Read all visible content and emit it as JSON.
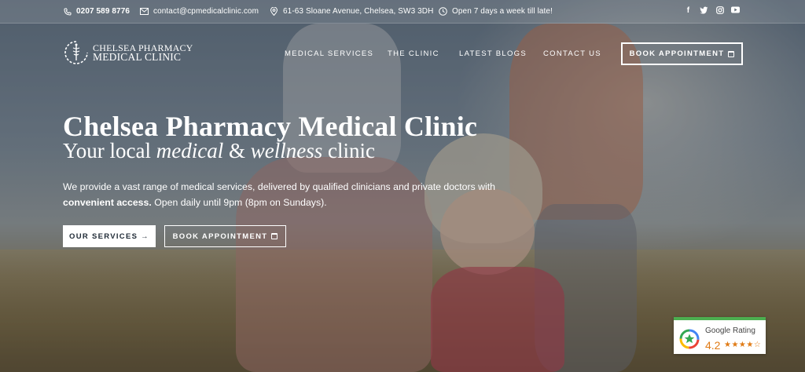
{
  "topbar": {
    "phone": "0207 589 8776",
    "email": "contact@cpmedicalclinic.com",
    "address": "61-63 Sloane Avenue, Chelsea, SW3 3DH",
    "hours": "Open 7 days a week till late!",
    "social": [
      "facebook-icon",
      "twitter-icon",
      "instagram-icon",
      "youtube-icon"
    ]
  },
  "header": {
    "logo_line1": "CHELSEA PHARMACY",
    "logo_line2": "MEDICAL CLINIC",
    "nav": [
      "MEDICAL SERVICES",
      "THE CLINIC",
      "LATEST BLOGS",
      "CONTACT US"
    ],
    "book_label": "BOOK APPOINTMENT"
  },
  "hero": {
    "title": "Chelsea Pharmacy Medical Clinic",
    "subtitle_pre": "Your local ",
    "subtitle_em1": "medical",
    "subtitle_mid": " & ",
    "subtitle_em2": "wellness",
    "subtitle_post": " clinic",
    "lead_text": "We provide a vast range of medical services, delivered by qualified clinicians and private doctors with ",
    "lead_bold": "convenient access.",
    "lead_tail": " Open daily until 9pm (8pm on Sundays).",
    "cta_services": "OUR SERVICES →",
    "cta_book": "BOOK APPOINTMENT"
  },
  "rating": {
    "label": "Google Rating",
    "score": "4.2",
    "stars": "★★★★☆",
    "stars_value": 4.2
  },
  "colors": {
    "accent_green": "#4caf50",
    "star_orange": "#e07b16",
    "overlay": "#18202c"
  }
}
